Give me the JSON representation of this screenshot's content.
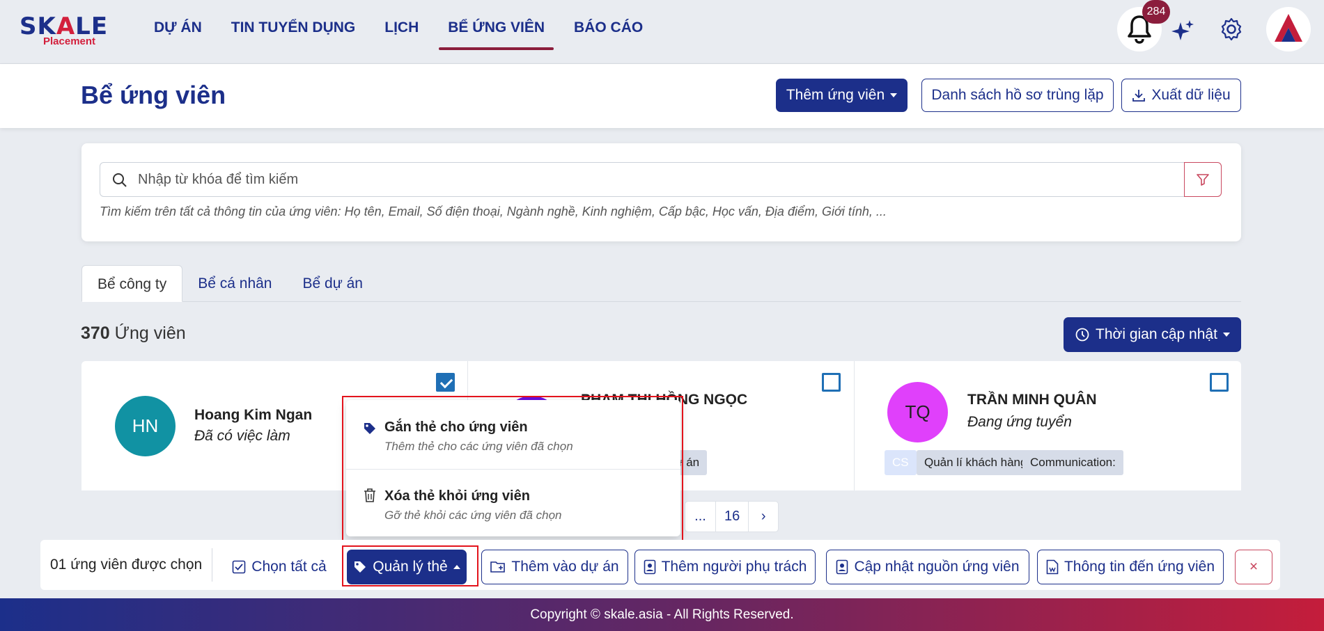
{
  "brand": {
    "name_prefix": "SK",
    "name_accent": "A",
    "name_suffix": "LE",
    "sub": "Placement"
  },
  "nav": {
    "items": [
      {
        "label": "DỰ ÁN"
      },
      {
        "label": "TIN TUYỂN DỤNG"
      },
      {
        "label": "LỊCH"
      },
      {
        "label": "BỂ ỨNG VIÊN",
        "active": true
      },
      {
        "label": "BÁO CÁO"
      }
    ],
    "notification_count": "284"
  },
  "page": {
    "title": "Bể ứng viên",
    "add_candidate_label": "Thêm ứng viên",
    "duplicate_list_label": "Danh sách hồ sơ trùng lặp",
    "export_label": "Xuất dữ liệu"
  },
  "search": {
    "placeholder": "Nhập từ khóa để tìm kiếm",
    "value": "",
    "hint": "Tìm kiếm trên tất cả thông tin của ứng viên: Họ tên, Email, Số điện thoại, Ngành nghề, Kinh nghiệm, Cấp bậc, Học vấn, Địa điểm, Giới tính, ..."
  },
  "tabs": [
    {
      "label": "Bể công ty",
      "active": true
    },
    {
      "label": "Bể cá nhân"
    },
    {
      "label": "Bể dự án"
    }
  ],
  "results": {
    "count": "370",
    "count_label": "Ứng viên",
    "sort_label": "Thời gian cập nhật"
  },
  "candidates": [
    {
      "initials": "HN",
      "name": "Hoang Kim Ngan",
      "status": "Đã có việc làm",
      "checked": true,
      "avatar_color": "#1192a3",
      "tags": []
    },
    {
      "initials": "",
      "name": "PHẠM THỊ HỒNG NGỌC",
      "status": "",
      "checked": false,
      "avatar_color": "#6a0ee0",
      "tags": [
        "Kỹ năng quản lý dự án"
      ]
    },
    {
      "initials": "TQ",
      "name": "TRẦN MINH QUÂN",
      "status": "Đang ứng tuyển",
      "checked": false,
      "avatar_color": "#e040fb",
      "tags": [
        "CS",
        "Quản lí khách hàng",
        "Communication:"
      ]
    }
  ],
  "pagination": {
    "ellipsis": "...",
    "last": "16",
    "next": "›"
  },
  "tag_menu": {
    "items": [
      {
        "title": "Gắn thẻ cho ứng viên",
        "desc": "Thêm thẻ cho các ứng viên đã chọn",
        "icon": "tag-icon"
      },
      {
        "title": "Xóa thẻ khỏi ứng viên",
        "desc": "Gỡ thẻ khỏi các ứng viên đã chọn",
        "icon": "trash-icon"
      }
    ]
  },
  "bulk_bar": {
    "selected_text": "01 ứng viên được chọn",
    "select_all": "Chọn tất cả",
    "manage_tags": "Quản lý thẻ",
    "add_to_project": "Thêm vào dự án",
    "add_owner": "Thêm người phụ trách",
    "update_source": "Cập nhật nguồn ứng viên",
    "send_info": "Thông tin đến ứng viên",
    "close": "×"
  },
  "footer": {
    "text": "Copyright © skale.asia - All Rights Reserved."
  },
  "colors": {
    "primary": "#1c2f8a",
    "accent": "#8b1d3c",
    "highlight": "#e3131c"
  }
}
